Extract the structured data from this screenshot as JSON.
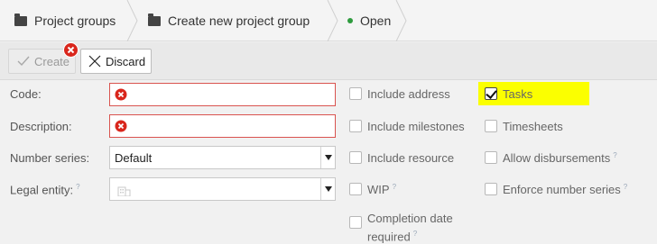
{
  "breadcrumb": {
    "items": [
      {
        "label": "Project groups",
        "icon": "folder-icon"
      },
      {
        "label": "Create new project group",
        "icon": "folder-icon"
      },
      {
        "label": "Open",
        "icon": "status-dot",
        "status_color": "#2e9b3e"
      }
    ]
  },
  "toolbar": {
    "create_label": "Create",
    "discard_label": "Discard"
  },
  "form": {
    "code": {
      "label": "Code:",
      "value": ""
    },
    "description": {
      "label": "Description:",
      "value": ""
    },
    "number_series": {
      "label": "Number series:",
      "value": "Default"
    },
    "legal_entity": {
      "label": "Legal entity:",
      "help": "?",
      "value": ""
    }
  },
  "options_left": [
    {
      "label": "Include address",
      "checked": false
    },
    {
      "label": "Include milestones",
      "checked": false
    },
    {
      "label": "Include resource",
      "checked": false
    },
    {
      "label": "WIP",
      "help": "?",
      "checked": false
    },
    {
      "label_line1": "Completion date",
      "label_line2": "required",
      "help": "?",
      "checked": false
    }
  ],
  "options_right": [
    {
      "label": "Tasks",
      "checked": true,
      "highlight": "#fbff00"
    },
    {
      "label": "Timesheets",
      "checked": false
    },
    {
      "label": "Allow disbursements",
      "help": "?",
      "checked": false
    },
    {
      "label": "Enforce number series",
      "help": "?",
      "checked": false
    }
  ],
  "colors": {
    "error": "#d9534f",
    "status": "#2e9b3e",
    "highlight": "#fbff00"
  }
}
